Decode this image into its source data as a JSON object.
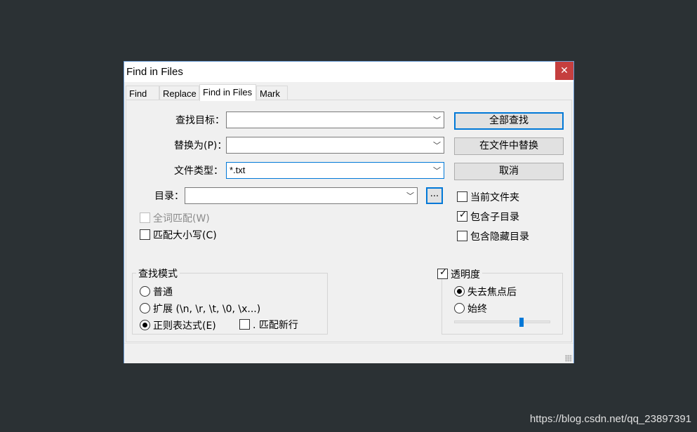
{
  "window": {
    "title": "Find in Files",
    "close_label": "✕"
  },
  "tabs": [
    {
      "label": "Find"
    },
    {
      "label": "Replace"
    },
    {
      "label": "Find in Files"
    },
    {
      "label": "Mark"
    }
  ],
  "fields": {
    "find_what_label": "查找目标：",
    "find_what_value": "",
    "replace_with_label": "替换为(P)：",
    "replace_with_value": "",
    "filters_label": "文件类型：",
    "filters_value": "*.txt",
    "directory_label": "目录：",
    "directory_value": "",
    "browse_label": "..."
  },
  "buttons": {
    "find_all": "全部查找",
    "replace_in_files": "在文件中替换",
    "cancel": "取消"
  },
  "options": {
    "whole_word": {
      "label": "全词匹配(W)",
      "checked": false,
      "enabled": false
    },
    "match_case": {
      "label": "匹配大小写(C)",
      "checked": false
    },
    "current_folder": {
      "label": "当前文件夹",
      "checked": false
    },
    "subfolders": {
      "label": "包含子目录",
      "checked": true
    },
    "hidden_folders": {
      "label": "包含隐藏目录",
      "checked": false
    }
  },
  "search_mode": {
    "legend": "查找模式",
    "normal": "普通",
    "extended": "扩展 (\\n, \\r, \\t, \\0, \\x...)",
    "regex": "正则表达式(E)",
    "dot_newline": ". 匹配新行",
    "selected": "regex"
  },
  "transparency": {
    "label": "透明度",
    "checked": true,
    "on_losing_focus": "失去焦点后",
    "always": "始终",
    "selected": "on_losing_focus",
    "level": 0.7
  },
  "watermark": "https://blog.csdn.net/qq_23897391"
}
